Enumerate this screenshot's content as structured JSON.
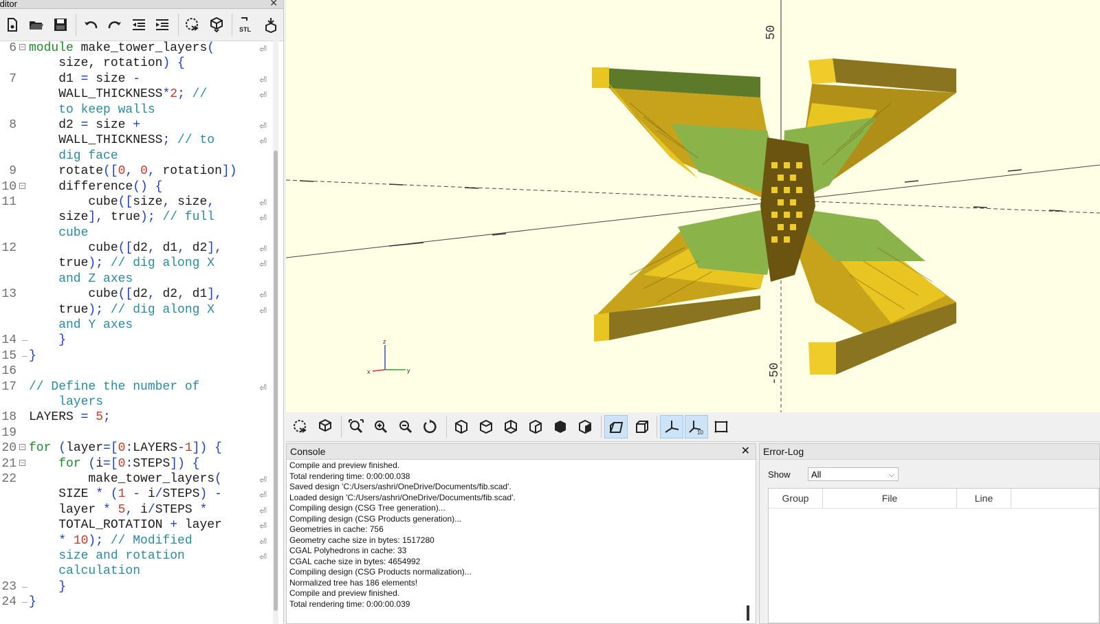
{
  "editor": {
    "title": "Editor",
    "code_lines": [
      {
        "ln": "6",
        "fold": "open",
        "parts": [
          [
            "kw",
            "module "
          ],
          [
            "",
            "make_tower_layers"
          ],
          [
            "sym",
            "("
          ]
        ],
        "wrap": true
      },
      {
        "ln": "",
        "parts": [
          [
            "",
            "    size, rotation"
          ],
          [
            "sym",
            ") {"
          ]
        ]
      },
      {
        "ln": "7",
        "parts": [
          [
            "",
            "    d1 "
          ],
          [
            "sym",
            "= "
          ],
          [
            "",
            "size "
          ],
          [
            "sym",
            "-"
          ]
        ],
        "wrap": true
      },
      {
        "ln": "",
        "parts": [
          [
            "",
            "    WALL_THICKNESS"
          ],
          [
            "sym",
            "*"
          ],
          [
            "nm",
            "2"
          ],
          [
            "sym",
            "; "
          ],
          [
            "cm",
            "//"
          ]
        ],
        "wrap": true
      },
      {
        "ln": "",
        "parts": [
          [
            "cm",
            "    to keep walls"
          ]
        ]
      },
      {
        "ln": "8",
        "parts": [
          [
            "",
            "    d2 "
          ],
          [
            "sym",
            "= "
          ],
          [
            "",
            "size "
          ],
          [
            "sym",
            "+"
          ]
        ],
        "wrap": true
      },
      {
        "ln": "",
        "parts": [
          [
            "",
            "    WALL_THICKNESS"
          ],
          [
            "sym",
            "; "
          ],
          [
            "cm",
            "// to"
          ]
        ],
        "wrap": true
      },
      {
        "ln": "",
        "parts": [
          [
            "cm",
            "    dig face"
          ]
        ]
      },
      {
        "ln": "9",
        "parts": [
          [
            "",
            "    rotate"
          ],
          [
            "sym",
            "(["
          ],
          [
            "nm",
            "0"
          ],
          [
            "sym",
            ", "
          ],
          [
            "nm",
            "0"
          ],
          [
            "sym",
            ", "
          ],
          [
            "",
            "rotation"
          ],
          [
            "sym",
            "])"
          ]
        ]
      },
      {
        "ln": "10",
        "fold": "open",
        "parts": [
          [
            "",
            "    difference"
          ],
          [
            "sym",
            "() {"
          ]
        ]
      },
      {
        "ln": "11",
        "parts": [
          [
            "",
            "        cube"
          ],
          [
            "sym",
            "(["
          ],
          [
            "",
            "size"
          ],
          [
            "sym",
            ", "
          ],
          [
            "",
            "size"
          ],
          [
            "sym",
            ","
          ]
        ],
        "wrap": true
      },
      {
        "ln": "",
        "parts": [
          [
            "",
            "    size"
          ],
          [
            "sym",
            "], "
          ],
          [
            "",
            "true"
          ],
          [
            "sym",
            "); "
          ],
          [
            "cm",
            "// full"
          ]
        ],
        "wrap": true
      },
      {
        "ln": "",
        "parts": [
          [
            "cm",
            "    cube"
          ]
        ]
      },
      {
        "ln": "12",
        "parts": [
          [
            "",
            "        cube"
          ],
          [
            "sym",
            "(["
          ],
          [
            "",
            "d2"
          ],
          [
            "sym",
            ", "
          ],
          [
            "",
            "d1"
          ],
          [
            "sym",
            ", "
          ],
          [
            "",
            "d2"
          ],
          [
            "sym",
            "],"
          ]
        ],
        "wrap": true
      },
      {
        "ln": "",
        "parts": [
          [
            "",
            "    true"
          ],
          [
            "sym",
            "); "
          ],
          [
            "cm",
            "// dig along X"
          ]
        ],
        "wrap": true
      },
      {
        "ln": "",
        "parts": [
          [
            "cm",
            "    and Z axes"
          ]
        ]
      },
      {
        "ln": "13",
        "parts": [
          [
            "",
            "        cube"
          ],
          [
            "sym",
            "(["
          ],
          [
            "",
            "d2"
          ],
          [
            "sym",
            ", "
          ],
          [
            "",
            "d2"
          ],
          [
            "sym",
            ", "
          ],
          [
            "",
            "d1"
          ],
          [
            "sym",
            "],"
          ]
        ],
        "wrap": true
      },
      {
        "ln": "",
        "parts": [
          [
            "",
            "    true"
          ],
          [
            "sym",
            "); "
          ],
          [
            "cm",
            "// dig along X"
          ]
        ],
        "wrap": true
      },
      {
        "ln": "",
        "parts": [
          [
            "cm",
            "    and Y axes"
          ]
        ]
      },
      {
        "ln": "14",
        "fold": "end",
        "parts": [
          [
            "sym",
            "    }"
          ]
        ]
      },
      {
        "ln": "15",
        "fold": "end",
        "parts": [
          [
            "sym",
            "}"
          ]
        ]
      },
      {
        "ln": "16",
        "parts": []
      },
      {
        "ln": "17",
        "parts": [
          [
            "cm",
            "// Define the number of"
          ]
        ],
        "wrap": true
      },
      {
        "ln": "",
        "parts": [
          [
            "cm",
            "    layers"
          ]
        ]
      },
      {
        "ln": "18",
        "parts": [
          [
            "",
            "LAYERS "
          ],
          [
            "sym",
            "= "
          ],
          [
            "nm",
            "5"
          ],
          [
            "sym",
            ";"
          ]
        ]
      },
      {
        "ln": "19",
        "parts": []
      },
      {
        "ln": "20",
        "fold": "open",
        "parts": [
          [
            "kw",
            "for "
          ],
          [
            "sym",
            "("
          ],
          [
            "",
            "layer"
          ],
          [
            "sym",
            "=["
          ],
          [
            "nm",
            "0"
          ],
          [
            "sym",
            ":"
          ],
          [
            "",
            "LAYERS"
          ],
          [
            "sym",
            "-"
          ],
          [
            "nm",
            "1"
          ],
          [
            "sym",
            "]) {"
          ]
        ]
      },
      {
        "ln": "21",
        "fold": "open",
        "parts": [
          [
            "kw",
            "    for "
          ],
          [
            "sym",
            "("
          ],
          [
            "",
            "i"
          ],
          [
            "sym",
            "=["
          ],
          [
            "nm",
            "0"
          ],
          [
            "sym",
            ":"
          ],
          [
            "",
            "STEPS"
          ],
          [
            "sym",
            "]) {"
          ]
        ]
      },
      {
        "ln": "22",
        "parts": [
          [
            "",
            "        make_tower_layers"
          ],
          [
            "sym",
            "("
          ]
        ],
        "wrap": true
      },
      {
        "ln": "",
        "parts": [
          [
            "",
            "    SIZE "
          ],
          [
            "sym",
            "* ("
          ],
          [
            "nm",
            "1"
          ],
          [
            "sym",
            " - "
          ],
          [
            "",
            "i"
          ],
          [
            "sym",
            "/"
          ],
          [
            "",
            "STEPS"
          ],
          [
            "sym",
            ") -"
          ]
        ],
        "wrap": true
      },
      {
        "ln": "",
        "parts": [
          [
            "",
            "    layer "
          ],
          [
            "sym",
            "* "
          ],
          [
            "nm",
            "5"
          ],
          [
            "sym",
            ", "
          ],
          [
            "",
            "i"
          ],
          [
            "sym",
            "/"
          ],
          [
            "",
            "STEPS "
          ],
          [
            "sym",
            "*"
          ]
        ],
        "wrap": true
      },
      {
        "ln": "",
        "parts": [
          [
            "",
            "    TOTAL_ROTATION "
          ],
          [
            "sym",
            "+ "
          ],
          [
            "",
            "layer"
          ]
        ],
        "wrap": true
      },
      {
        "ln": "",
        "parts": [
          [
            "sym",
            "    * "
          ],
          [
            "nm",
            "10"
          ],
          [
            "sym",
            "); "
          ],
          [
            "cm",
            "// Modified"
          ]
        ],
        "wrap": true
      },
      {
        "ln": "",
        "parts": [
          [
            "cm",
            "    size and rotation"
          ]
        ],
        "wrap": true
      },
      {
        "ln": "",
        "parts": [
          [
            "cm",
            "    calculation"
          ]
        ]
      },
      {
        "ln": "23",
        "fold": "end",
        "parts": [
          [
            "sym",
            "    }"
          ]
        ]
      },
      {
        "ln": "24",
        "fold": "end",
        "parts": [
          [
            "sym",
            "}"
          ]
        ]
      }
    ]
  },
  "viewport": {
    "axis_label_top": "50",
    "axis_label_bottom": "-50",
    "gizmo": {
      "z": "z",
      "x": "x",
      "y": "y"
    },
    "colors": {
      "background": "#ffffe5",
      "yellow": "#e8c521",
      "green": "#8ab44a"
    }
  },
  "console": {
    "title": "Console",
    "lines": [
      "Compile and preview finished.",
      "Total rendering time: 0:00:00.038",
      "Saved design 'C:/Users/ashri/OneDrive/Documents/fib.scad'.",
      "Loaded design 'C:/Users/ashri/OneDrive/Documents/fib.scad'.",
      "Compiling design (CSG Tree generation)...",
      "Compiling design (CSG Products generation)...",
      "Geometries in cache: 756",
      "Geometry cache size in bytes: 1517280",
      "CGAL Polyhedrons in cache: 33",
      "CGAL cache size in bytes: 4654992",
      "Compiling design (CSG Products normalization)...",
      "Normalized tree has 186 elements!",
      "Compile and preview finished.",
      "Total rendering time: 0:00:00.039"
    ]
  },
  "errorlog": {
    "title": "Error-Log",
    "show_label": "Show",
    "show_value": "All",
    "columns": [
      "Group",
      "File",
      "Line"
    ]
  }
}
